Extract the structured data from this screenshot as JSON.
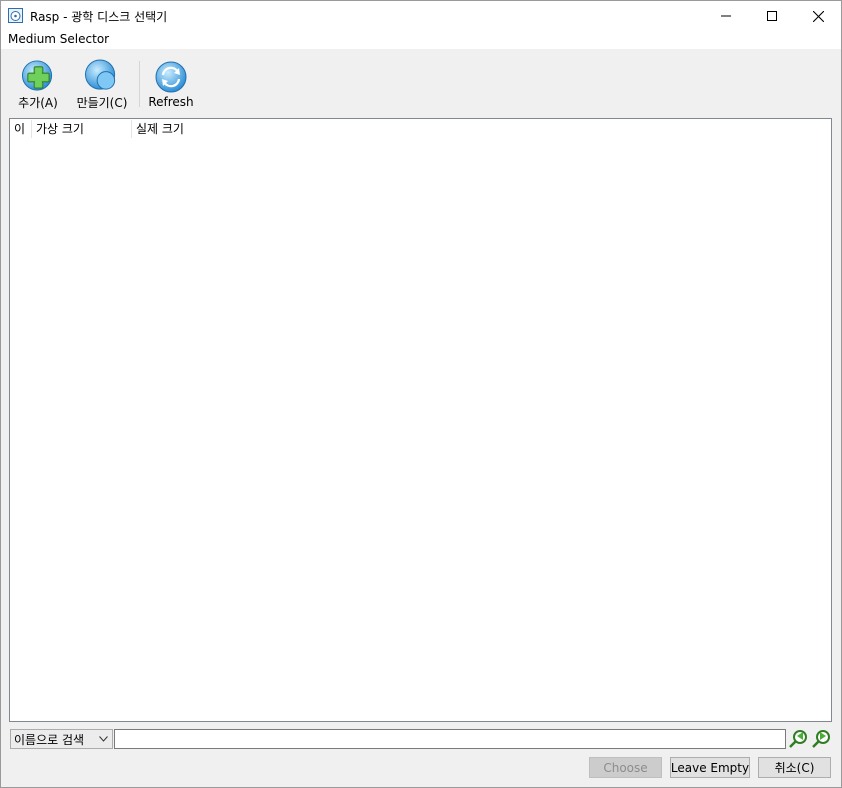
{
  "window": {
    "title": "Rasp - 광학 디스크 선택기",
    "icon": "optical-disc-icon"
  },
  "menubar": {
    "label": "Medium Selector"
  },
  "toolbar": {
    "add_label": "추가(A)",
    "create_label": "만들기(C)",
    "refresh_label": "Refresh"
  },
  "list": {
    "columns": [
      "이",
      "가상 크기",
      "실제 크기"
    ],
    "rows": []
  },
  "search": {
    "mode_label": "이름으로 검색",
    "value": ""
  },
  "buttons": {
    "choose": "Choose",
    "leave_empty": "Leave Empty",
    "cancel": "취소(C)"
  },
  "colors": {
    "accent_green": "#4cae3a",
    "accent_blue": "#3a9bdc"
  }
}
